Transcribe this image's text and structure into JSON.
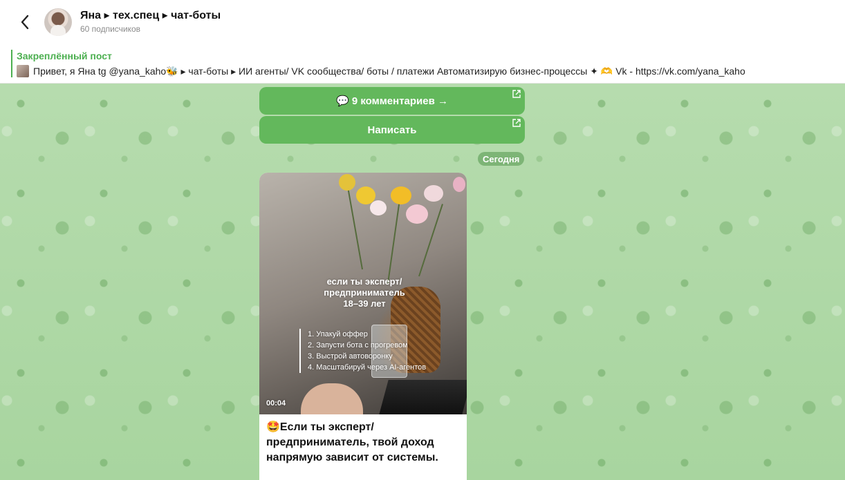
{
  "header": {
    "title": "Яна ▸ тех.спец ▸ чат-боты",
    "subscribers": "60 подписчиков"
  },
  "pinned": {
    "title": "Закреплённый пост",
    "text": "Привет, я Яна tg @yana_kaho🐝 ▸ чат-боты ▸ ИИ агенты/ VK сообщества/ боты / платежи Автоматизирую бизнес-процессы ✦ 🫶 Vk - https://vk.com/yana_kaho"
  },
  "buttons": {
    "comments": "💬 9 комментариев →",
    "write": "Написать"
  },
  "date": "Сегодня",
  "post": {
    "video_title": "если ты эксперт/\nпредприниматель\n18–39 лет",
    "video_list": [
      "1. Упакуй оффер",
      "2. Запусти бота с прогревом",
      "3. Выстрой автоворонку",
      "4. Масштабируй через AI-агентов"
    ],
    "duration": "00:04",
    "caption_emoji": "🤩",
    "caption": "Если ты эксперт/ предприниматель, твой доход напрямую зависит от системы."
  },
  "colors": {
    "accent": "#4caf50",
    "button": "#63b85c",
    "chat_bg": "#a9d6a1"
  }
}
